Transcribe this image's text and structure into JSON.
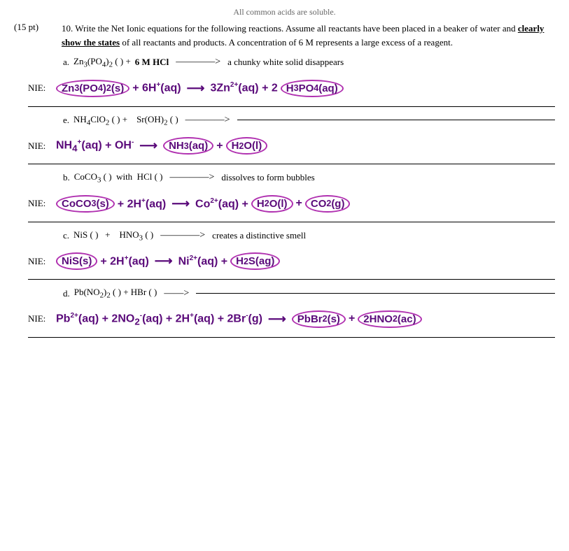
{
  "header_note": "All common acids are soluble.",
  "problem": {
    "points": "(15 pt)",
    "number": "10.",
    "text": "Write the Net Ionic equations for the following reactions.  Assume all reactants have been placed in a beaker of water and ",
    "text_bold": "clearly show the states",
    "text_end": " of all reactants and products.  A concentration of 6 M represents a large excess of a reagent.",
    "nie_label": "NIE:"
  },
  "sub_problems": [
    {
      "letter": "a.",
      "reactants": "Zn₃(PO₄)₂ (  ) +",
      "reagent": "6 M HCl",
      "arrow": "———>",
      "product_text": "a chunky white solid disappears",
      "nie": {
        "parts": [
          {
            "type": "circled",
            "text": "Zn₃(PO₄)₂(s)"
          },
          {
            "type": "plain",
            "text": " + 6H⁺(aq) "
          },
          {
            "type": "arrow",
            "text": "⟶"
          },
          {
            "type": "plain",
            "text": " 3Zn"
          },
          {
            "type": "sup",
            "text": "2+"
          },
          {
            "type": "plain",
            "text": "(aq) + 2"
          },
          {
            "type": "circled",
            "text": "H₃PO₄(aq)"
          }
        ]
      }
    },
    {
      "letter": "e.",
      "reactants": "NH₄ClO₂ (  ) +    Sr(OH)₂ (  )",
      "arrow": "———>",
      "nie": {
        "parts": [
          {
            "type": "plain",
            "text": "NH₄⁺(aq)  +  OH⁻"
          },
          {
            "type": "arrow",
            "text": "⟶"
          },
          {
            "type": "circled",
            "text": "NH₃(aq)"
          },
          {
            "type": "plain",
            "text": " + "
          },
          {
            "type": "circled",
            "text": "H₂O(l)"
          }
        ]
      }
    },
    {
      "letter": "b.",
      "reactants": "CoCO₃ (  )  with  HCl (  )",
      "arrow": "————>",
      "product_text": "dissolves to form bubbles",
      "nie": {
        "parts": [
          {
            "type": "circled",
            "text": "CoCO₃(s)"
          },
          {
            "type": "plain",
            "text": " + 2H⁺(aq) "
          },
          {
            "type": "arrow",
            "text": "⟶"
          },
          {
            "type": "plain",
            "text": " Co"
          },
          {
            "type": "sup",
            "text": "2+"
          },
          {
            "type": "plain",
            "text": "(aq)  + "
          },
          {
            "type": "circled",
            "text": "H₂O(l)"
          },
          {
            "type": "plain",
            "text": ""
          },
          {
            "type": "circled",
            "text": "CO₂(g)"
          }
        ]
      }
    },
    {
      "letter": "c.",
      "reactants": "NiS (  )   +    HNO₃ (  )",
      "arrow": "————>",
      "product_text": "creates a distinctive smell",
      "nie": {
        "parts": [
          {
            "type": "circled",
            "text": "NiS(s)"
          },
          {
            "type": "plain",
            "text": " + 2H⁺(aq) "
          },
          {
            "type": "arrow",
            "text": "⟶"
          },
          {
            "type": "plain",
            "text": " Ni"
          },
          {
            "type": "sup",
            "text": "2+"
          },
          {
            "type": "plain",
            "text": "(aq)  + "
          },
          {
            "type": "circled",
            "text": "H₂S(ag)"
          }
        ]
      }
    },
    {
      "letter": "d.",
      "reactants": "Pb(NO₂)₂ (  )  +  HBr (  )",
      "arrow": "——>",
      "nie": {
        "parts": [
          {
            "type": "plain",
            "text": "Pb"
          },
          {
            "type": "sup",
            "text": "2+"
          },
          {
            "type": "plain",
            "text": "(aq) + 2NO₂⁻(aq) + 2H⁺(aq) + 2Br⁻(g) "
          },
          {
            "type": "arrow",
            "text": "⟶"
          },
          {
            "type": "circled",
            "text": "PbBr₂(s)"
          },
          {
            "type": "plain",
            "text": " + "
          },
          {
            "type": "circled",
            "text": "2HNO₂(ac)"
          }
        ]
      }
    }
  ]
}
